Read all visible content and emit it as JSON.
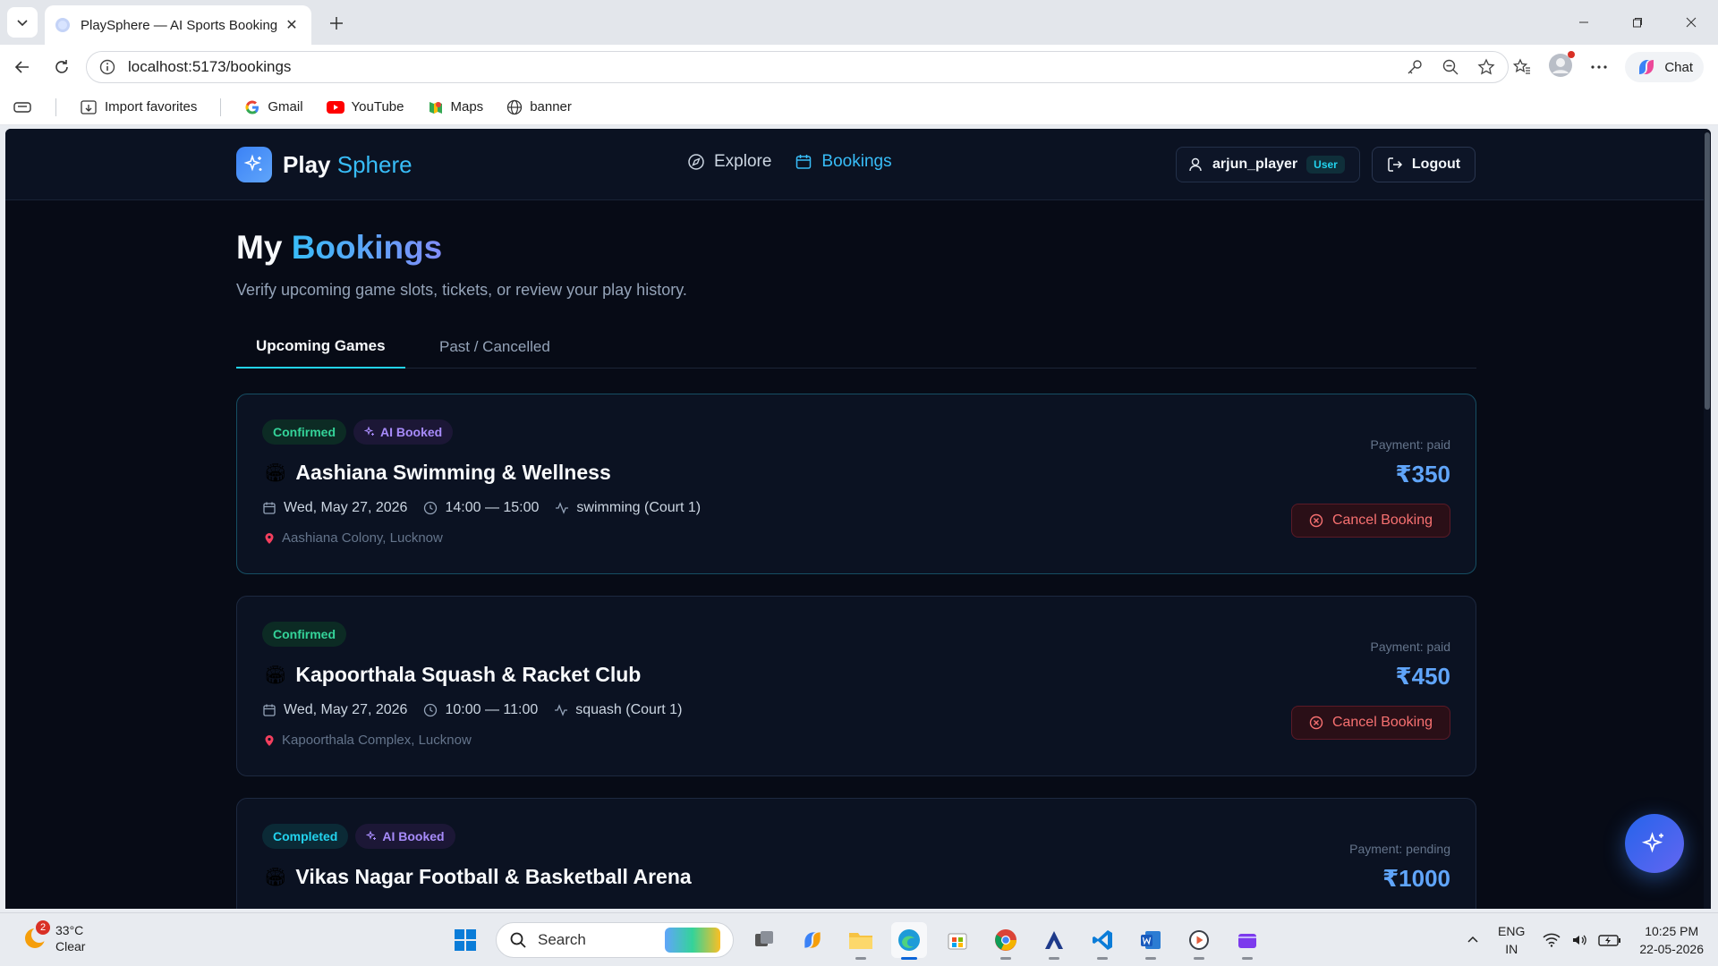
{
  "browser": {
    "tab_title": "PlaySphere — AI Sports Booking",
    "url": "localhost:5173/bookings",
    "chat_label": "Chat",
    "favorites": [
      {
        "label": "Import favorites"
      },
      {
        "label": "Gmail"
      },
      {
        "label": "YouTube"
      },
      {
        "label": "Maps"
      },
      {
        "label": "banner"
      }
    ]
  },
  "app": {
    "brand_main": "Play",
    "brand_accent": "Sphere",
    "nav": [
      {
        "label": "Explore",
        "active": false
      },
      {
        "label": "Bookings",
        "active": true
      }
    ],
    "user": {
      "name": "arjun_player",
      "role": "User"
    },
    "logout_label": "Logout"
  },
  "page": {
    "title_main": "My",
    "title_accent": "Bookings",
    "subtitle": "Verify upcoming game slots, tickets, or review your play history.",
    "tabs": [
      {
        "label": "Upcoming Games",
        "active": true
      },
      {
        "label": "Past / Cancelled",
        "active": false
      }
    ]
  },
  "bookings": [
    {
      "status": "Confirmed",
      "ai_badge": "AI Booked",
      "venue": "Aashiana Swimming & Wellness",
      "date": "Wed, May 27, 2026",
      "time": "14:00 — 15:00",
      "sport": "swimming (Court 1)",
      "location": "Aashiana Colony, Lucknow",
      "payment": "Payment: paid",
      "price": "₹350",
      "cancel_label": "Cancel Booking"
    },
    {
      "status": "Confirmed",
      "venue": "Kapoorthala Squash & Racket Club",
      "date": "Wed, May 27, 2026",
      "time": "10:00 — 11:00",
      "sport": "squash (Court 1)",
      "location": "Kapoorthala Complex, Lucknow",
      "payment": "Payment: paid",
      "price": "₹450",
      "cancel_label": "Cancel Booking"
    },
    {
      "status": "Completed",
      "ai_badge": "AI Booked",
      "venue": "Vikas Nagar Football & Basketball Arena",
      "payment": "Payment: pending",
      "price": "₹1000"
    }
  ],
  "taskbar": {
    "weather_temp": "33°C",
    "weather_desc": "Clear",
    "weather_alerts": "2",
    "search_label": "Search",
    "lang_top": "ENG",
    "lang_bottom": "IN",
    "time": "10:25 PM",
    "date": "22-05-2026"
  }
}
